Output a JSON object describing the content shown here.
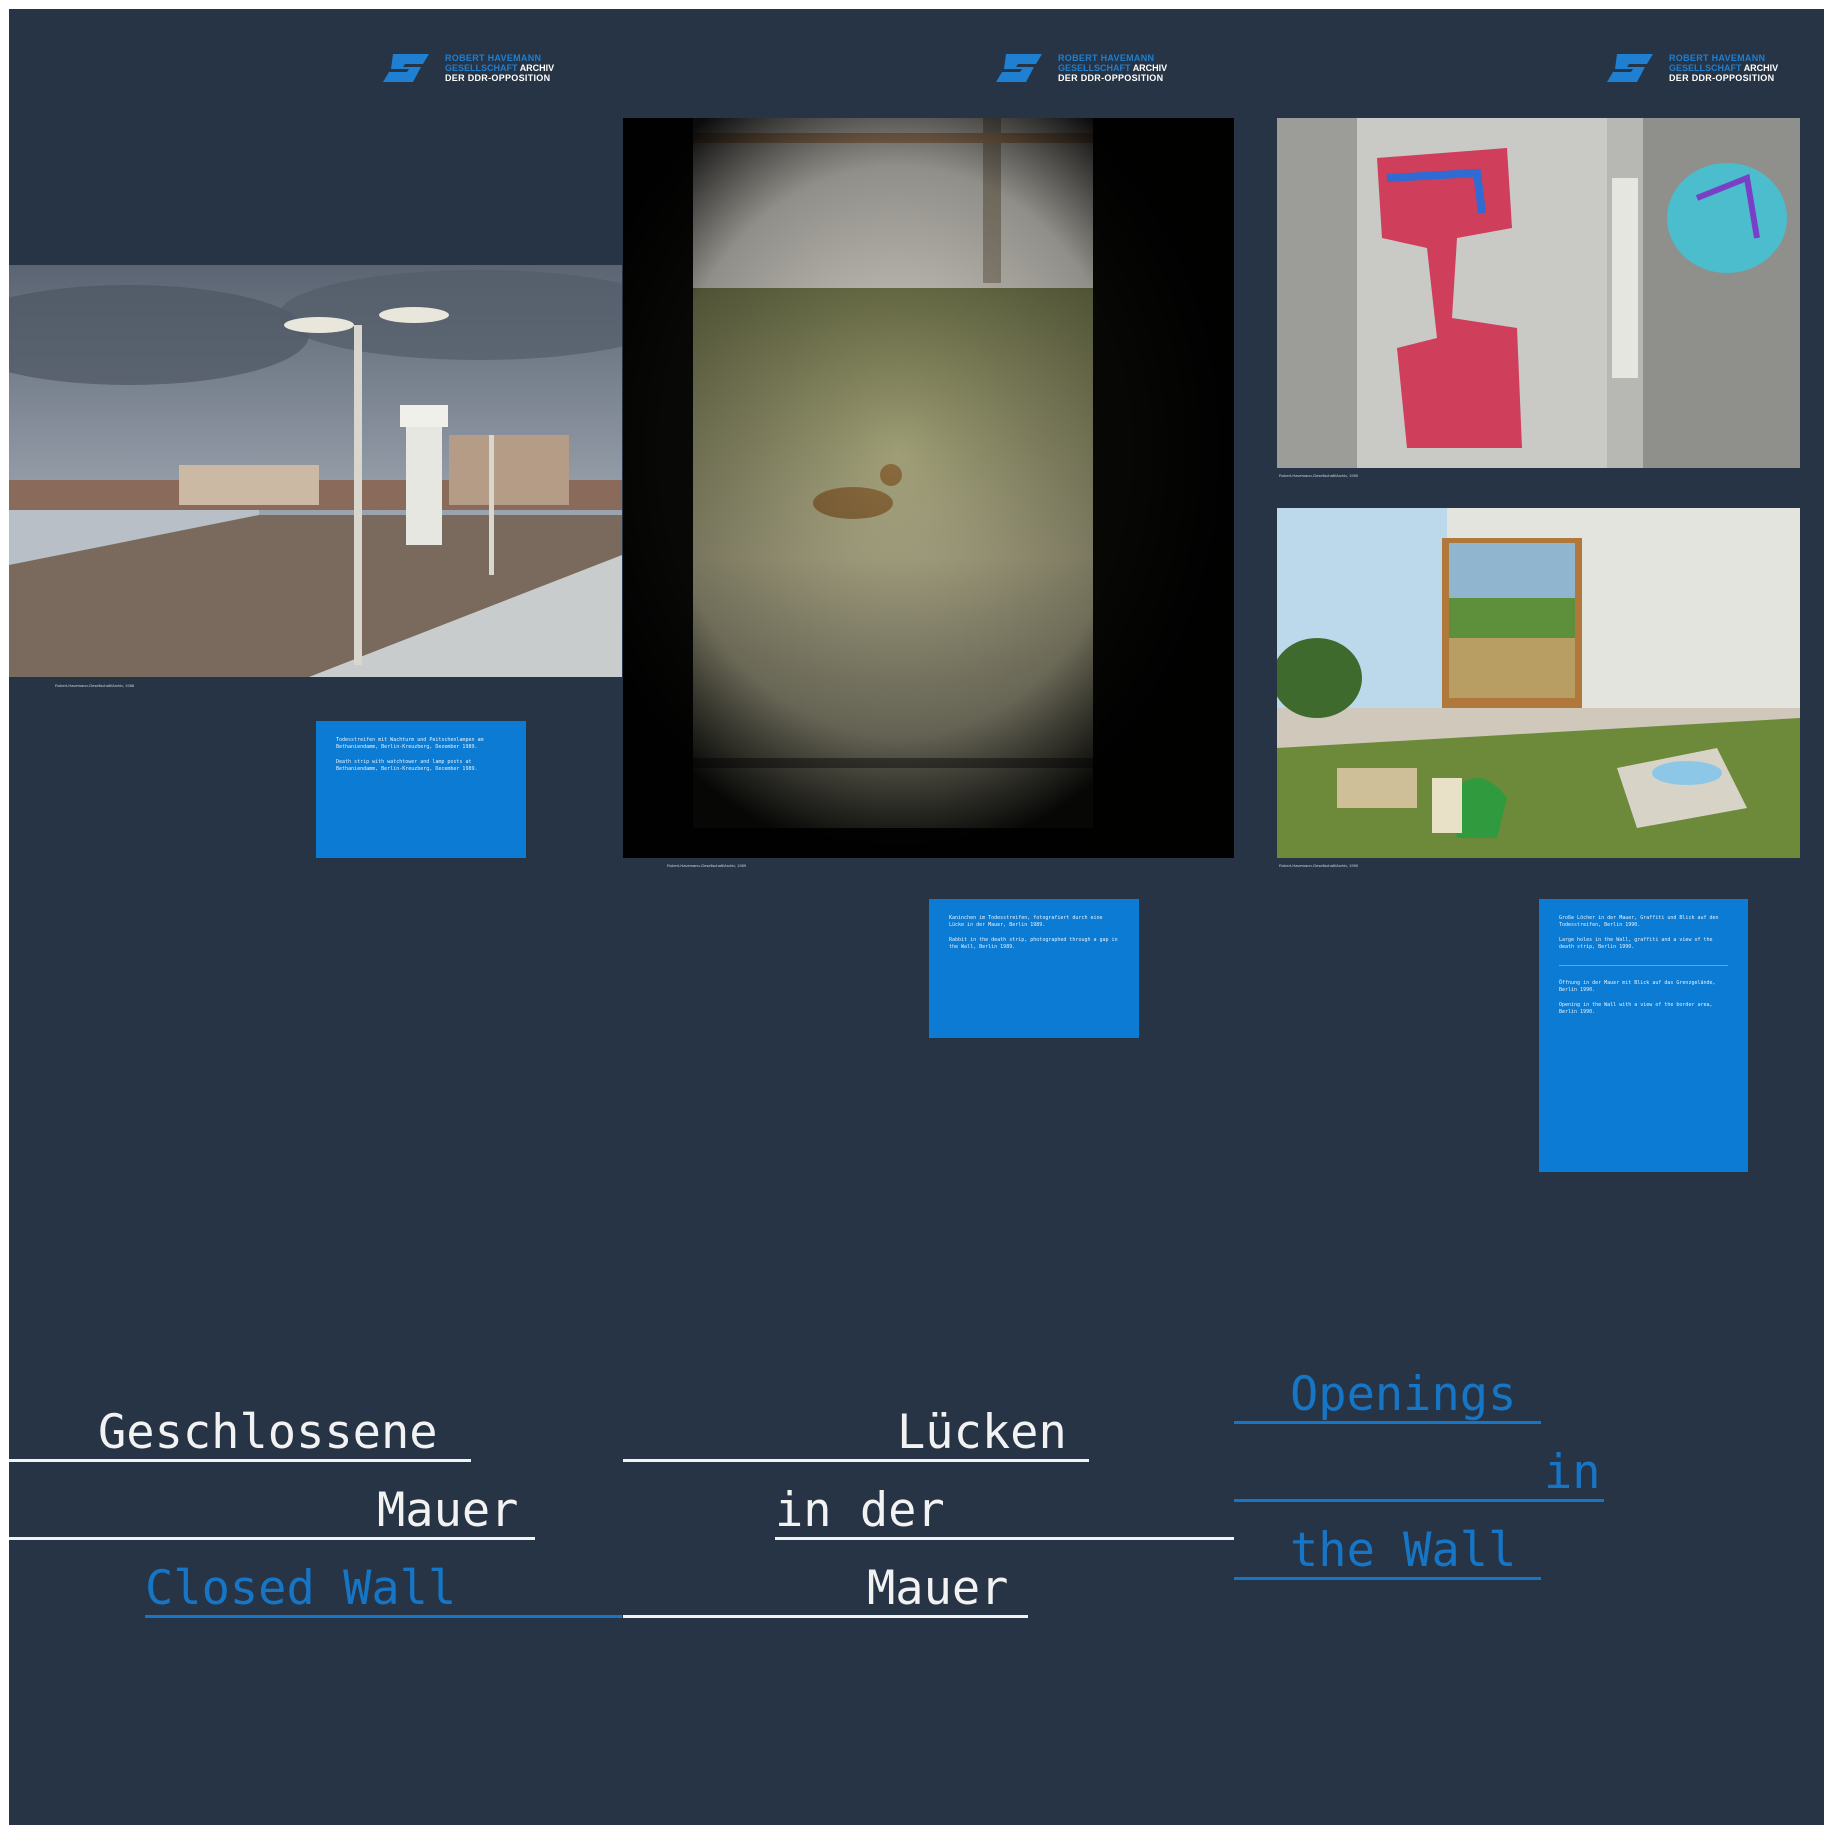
{
  "logo": {
    "line1": "ROBERT HAVEMANN",
    "line2": "GESELLSCHAFT",
    "line2_suffix": "ARCHIV",
    "line3": "DER DDR-OPPOSITION"
  },
  "panels": [
    {
      "photo": "watchtower-border-strip-photo",
      "credit": "Robert-Havemann-Gesellschaft/Archiv, 1988",
      "note": {
        "paragraphs": [
          "Todesstreifen mit Wachturm und Peitschenlampen am Bethaniendamm, Berlin-Kreuzberg, Dezember 1989.",
          "Death strip with watchtower and lamp posts at Bethaniendamm, Berlin-Kreuzberg, December 1989."
        ]
      },
      "title_de": [
        "Geschlossene",
        "Mauer"
      ],
      "title_en": [
        "Closed Wall"
      ]
    },
    {
      "photo": "rabbit-through-wall-gap-photo",
      "credit": "Robert-Havemann-Gesellschaft/Archiv, 1989",
      "note": {
        "paragraphs": [
          "Kaninchen im Todesstreifen, fotografiert durch eine Lücke in der Mauer, Berlin 1989.",
          "Rabbit in the death strip, photographed through a gap in the Wall, Berlin 1989."
        ]
      },
      "title_de": [
        "Lücken",
        "in der",
        "Mauer"
      ]
    },
    {
      "photo_top": "graffiti-wall-hole-photo",
      "photo_bottom": "wall-window-watering-can-photo",
      "credit_top": "Robert-Havemann-Gesellschaft/Archiv, 1990",
      "credit_bottom": "Robert-Havemann-Gesellschaft/Archiv, 1990",
      "note": {
        "paragraphs_top": [
          "Große Löcher in der Mauer, Graffiti und Blick auf den Todesstreifen, Berlin 1990.",
          "Large holes in the Wall, graffiti and a view of the death strip, Berlin 1990."
        ],
        "paragraphs_bottom": [
          "Öffnung in der Mauer mit Blick auf das Grenzgelände, Berlin 1990.",
          "Opening in the Wall with a view of the border area, Berlin 1990."
        ]
      },
      "title_en": [
        "Openings",
        "in",
        "the Wall"
      ]
    }
  ],
  "colors": {
    "background": "#263445",
    "accent_blue": "#1775c6",
    "note_blue": "#0b7bd3",
    "title_white": "#f2f2f2"
  }
}
